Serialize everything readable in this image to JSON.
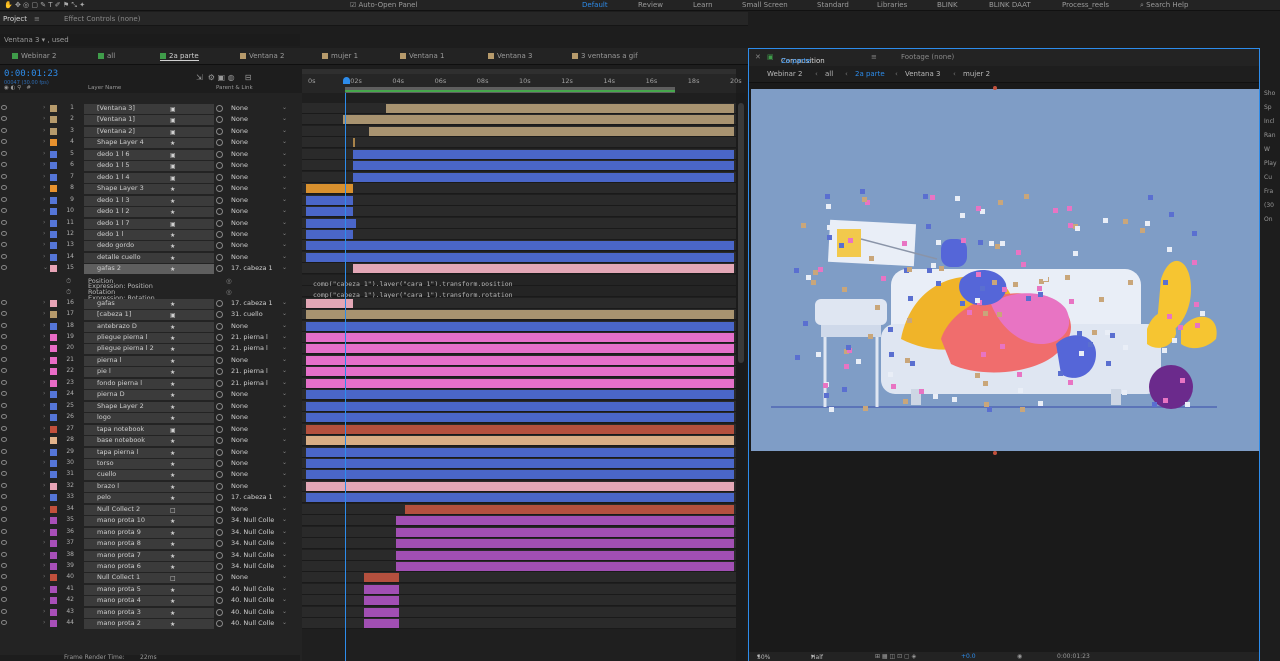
{
  "menubar": {
    "auto_open": "Auto-Open Panel",
    "workspaces": [
      {
        "label": "Default",
        "active": true
      },
      {
        "label": "Review",
        "active": false
      },
      {
        "label": "Learn",
        "active": false
      },
      {
        "label": "Small Screen",
        "active": false
      },
      {
        "label": "Standard",
        "active": false
      },
      {
        "label": "Libraries",
        "active": false
      },
      {
        "label": "BLINK",
        "active": false
      },
      {
        "label": "BLINK DAAT",
        "active": false
      },
      {
        "label": "Process_reels",
        "active": false
      }
    ],
    "search_label": "Search Help"
  },
  "panels": {
    "project": "Project",
    "effect_controls": "Effect Controls (none)",
    "project_item": "Ventana 3 ▾ , used"
  },
  "comp_tabs": [
    {
      "label": "Webinar 2",
      "color": "#3f9c4a",
      "active": false
    },
    {
      "label": "all",
      "color": "#3f9c4a",
      "active": false
    },
    {
      "label": "2a parte",
      "color": "#3f9c4a",
      "active": true
    },
    {
      "label": "Ventana 2",
      "color": "#b69a6b",
      "active": false
    },
    {
      "label": "mujer 1",
      "color": "#b69a6b",
      "active": false
    },
    {
      "label": "Ventana 1",
      "color": "#b69a6b",
      "active": false
    },
    {
      "label": "Ventana 3",
      "color": "#b69a6b",
      "active": false
    },
    {
      "label": "3 ventanas a gif",
      "color": "#b69a6b",
      "active": false
    }
  ],
  "timeline": {
    "timecode": "0:00:01:23",
    "fps": "00047 (30.00 fps)",
    "col_layer_name": "Layer Name",
    "col_parent": "Parent & Link",
    "ruler_ticks": [
      "0s",
      "02s",
      "04s",
      "06s",
      "08s",
      "10s",
      "12s",
      "14s",
      "16s",
      "18s",
      "20s"
    ],
    "frame_render": "Frame Render Time:",
    "frame_render_value": "22ms"
  },
  "layers": [
    {
      "n": "1",
      "name": "[Ventana 3]",
      "parent": "None",
      "label": "#b69a6b",
      "bar": "#a89370",
      "start": 0.19,
      "end": 1.0,
      "kind": "comp"
    },
    {
      "n": "2",
      "name": "[Ventana 1]",
      "parent": "None",
      "label": "#b69a6b",
      "bar": "#a89370",
      "start": 0.09,
      "end": 1.0,
      "kind": "comp"
    },
    {
      "n": "3",
      "name": "[Ventana 2]",
      "parent": "None",
      "label": "#b69a6b",
      "bar": "#a89370",
      "start": 0.15,
      "end": 1.0,
      "kind": "comp"
    },
    {
      "n": "4",
      "name": "Shape Layer 4",
      "parent": "None",
      "label": "#e8922e",
      "bar": "#a8834a",
      "start": 0.113,
      "end": 0.116,
      "kind": "shape"
    },
    {
      "n": "5",
      "name": "dedo 1 l 6",
      "parent": "None",
      "label": "#5576d8",
      "bar": "#4a66c8",
      "start": 0.115,
      "end": 1.0,
      "kind": "comp"
    },
    {
      "n": "6",
      "name": "dedo 1 l 5",
      "parent": "None",
      "label": "#5576d8",
      "bar": "#4a66c8",
      "start": 0.115,
      "end": 1.0,
      "kind": "comp"
    },
    {
      "n": "7",
      "name": "dedo 1 l 4",
      "parent": "None",
      "label": "#5576d8",
      "bar": "#4a66c8",
      "start": 0.115,
      "end": 1.0,
      "kind": "comp"
    },
    {
      "n": "8",
      "name": "Shape Layer 3",
      "parent": "None",
      "label": "#e8922e",
      "bar": "#d8902e",
      "start": 0.005,
      "end": 0.115,
      "kind": "shape"
    },
    {
      "n": "9",
      "name": "dedo 1 l 3",
      "parent": "None",
      "label": "#5576d8",
      "bar": "#4a66c8",
      "start": 0.005,
      "end": 0.115,
      "kind": "shape"
    },
    {
      "n": "10",
      "name": "dedo 1 l 2",
      "parent": "None",
      "label": "#5576d8",
      "bar": "#4a66c8",
      "start": 0.005,
      "end": 0.115,
      "kind": "shape"
    },
    {
      "n": "11",
      "name": "dedo 1 l 7",
      "parent": "None",
      "label": "#5576d8",
      "bar": "#4a66c8",
      "start": 0.005,
      "end": 0.12,
      "kind": "comp"
    },
    {
      "n": "12",
      "name": "dedo 1 l",
      "parent": "None",
      "label": "#5576d8",
      "bar": "#4a66c8",
      "start": 0.005,
      "end": 0.115,
      "kind": "shape"
    },
    {
      "n": "13",
      "name": "dedo gordo",
      "parent": "None",
      "label": "#5576d8",
      "bar": "#4a66c8",
      "start": 0.005,
      "end": 1.0,
      "kind": "shape"
    },
    {
      "n": "14",
      "name": "detalle cuello",
      "parent": "None",
      "label": "#5576d8",
      "bar": "#4a66c8",
      "start": 0.005,
      "end": 1.0,
      "kind": "shape"
    },
    {
      "n": "15",
      "name": "gafas 2",
      "parent": "17. cabeza 1",
      "label": "#e8a4b6",
      "bar": "#e3a7b6",
      "start": 0.115,
      "end": 1.0,
      "kind": "shape",
      "sel": true,
      "open": true
    },
    {
      "prop": "Position",
      "expr_label": "Expression: Position",
      "expr": "comp(\"cabeza 1\").layer(\"cara 1\").transform.position"
    },
    {
      "prop": "Rotation",
      "expr_label": "Expression: Rotation",
      "expr": "comp(\"cabeza 1\").layer(\"cara 1\").transform.rotation"
    },
    {
      "n": "16",
      "name": "gafas",
      "parent": "17. cabeza 1",
      "label": "#e8a4b6",
      "bar": "#e3a7b6",
      "start": 0.005,
      "end": 0.115,
      "kind": "shape"
    },
    {
      "n": "17",
      "name": "[cabeza 1]",
      "parent": "31. cuello",
      "label": "#b69a6b",
      "bar": "#a89370",
      "start": 0.005,
      "end": 1.0,
      "kind": "comp"
    },
    {
      "n": "18",
      "name": "antebrazo D",
      "parent": "None",
      "label": "#5576d8",
      "bar": "#4a66c8",
      "start": 0.005,
      "end": 1.0,
      "kind": "shape"
    },
    {
      "n": "19",
      "name": "pliegue pierna l",
      "parent": "21. pierna l",
      "label": "#e96bc6",
      "bar": "#e56fc9",
      "start": 0.005,
      "end": 1.0,
      "kind": "shape"
    },
    {
      "n": "20",
      "name": "pliegue pierna l 2",
      "parent": "21. pierna l",
      "label": "#e96bc6",
      "bar": "#e56fc9",
      "start": 0.005,
      "end": 1.0,
      "kind": "shape"
    },
    {
      "n": "21",
      "name": "pierna l",
      "parent": "None",
      "label": "#e96bc6",
      "bar": "#e56fc9",
      "start": 0.005,
      "end": 1.0,
      "kind": "shape"
    },
    {
      "n": "22",
      "name": "pie l",
      "parent": "21. pierna l",
      "label": "#e96bc6",
      "bar": "#e56fc9",
      "start": 0.005,
      "end": 1.0,
      "kind": "shape"
    },
    {
      "n": "23",
      "name": "fondo pierna l",
      "parent": "21. pierna l",
      "label": "#e96bc6",
      "bar": "#e56fc9",
      "start": 0.005,
      "end": 1.0,
      "kind": "shape"
    },
    {
      "n": "24",
      "name": "pierna D",
      "parent": "None",
      "label": "#5576d8",
      "bar": "#4a66c8",
      "start": 0.005,
      "end": 1.0,
      "kind": "shape"
    },
    {
      "n": "25",
      "name": "Shape Layer 2",
      "parent": "None",
      "label": "#5576d8",
      "bar": "#4a66c8",
      "start": 0.005,
      "end": 1.0,
      "kind": "shape"
    },
    {
      "n": "26",
      "name": "logo",
      "parent": "None",
      "label": "#5576d8",
      "bar": "#4a66c8",
      "start": 0.005,
      "end": 1.0,
      "kind": "shape"
    },
    {
      "n": "27",
      "name": "tapa notebook",
      "parent": "None",
      "label": "#c2503c",
      "bar": "#b4503e",
      "start": 0.005,
      "end": 1.0,
      "kind": "comp"
    },
    {
      "n": "28",
      "name": "base notebook",
      "parent": "None",
      "label": "#e3b48b",
      "bar": "#d8ad85",
      "start": 0.005,
      "end": 1.0,
      "kind": "shape"
    },
    {
      "n": "29",
      "name": "tapa pierna l",
      "parent": "None",
      "label": "#5576d8",
      "bar": "#4a66c8",
      "start": 0.005,
      "end": 1.0,
      "kind": "shape"
    },
    {
      "n": "30",
      "name": "torso",
      "parent": "None",
      "label": "#5576d8",
      "bar": "#4a66c8",
      "start": 0.005,
      "end": 1.0,
      "kind": "shape"
    },
    {
      "n": "31",
      "name": "cuello",
      "parent": "None",
      "label": "#5576d8",
      "bar": "#4a66c8",
      "start": 0.005,
      "end": 1.0,
      "kind": "shape"
    },
    {
      "n": "32",
      "name": "brazo l",
      "parent": "None",
      "label": "#e8a4b6",
      "bar": "#e3a7b6",
      "start": 0.005,
      "end": 1.0,
      "kind": "shape"
    },
    {
      "n": "33",
      "name": "pelo",
      "parent": "17. cabeza 1",
      "label": "#5576d8",
      "bar": "#4a66c8",
      "start": 0.005,
      "end": 1.0,
      "kind": "shape"
    },
    {
      "n": "34",
      "name": "Null Collect  2",
      "parent": "None",
      "label": "#c2503c",
      "bar": "#b4503e",
      "start": 0.235,
      "end": 1.0,
      "kind": "null"
    },
    {
      "n": "35",
      "name": "mano prota 10",
      "parent": "34. Null Colle",
      "label": "#a84fb8",
      "bar": "#a14fb3",
      "start": 0.215,
      "end": 1.0,
      "kind": "shape"
    },
    {
      "n": "36",
      "name": "mano prota 9",
      "parent": "34. Null Colle",
      "label": "#a84fb8",
      "bar": "#a14fb3",
      "start": 0.215,
      "end": 1.0,
      "kind": "shape"
    },
    {
      "n": "37",
      "name": "mano prota 8",
      "parent": "34. Null Colle",
      "label": "#a84fb8",
      "bar": "#a14fb3",
      "start": 0.215,
      "end": 1.0,
      "kind": "shape"
    },
    {
      "n": "38",
      "name": "mano prota 7",
      "parent": "34. Null Colle",
      "label": "#a84fb8",
      "bar": "#a14fb3",
      "start": 0.215,
      "end": 1.0,
      "kind": "shape"
    },
    {
      "n": "39",
      "name": "mano prota 6",
      "parent": "34. Null Colle",
      "label": "#a84fb8",
      "bar": "#a14fb3",
      "start": 0.215,
      "end": 1.0,
      "kind": "shape"
    },
    {
      "n": "40",
      "name": "Null Collect  1",
      "parent": "None",
      "label": "#c2503c",
      "bar": "#b4503e",
      "start": 0.14,
      "end": 0.22,
      "kind": "null"
    },
    {
      "n": "41",
      "name": "mano prota 5",
      "parent": "40. Null Colle",
      "label": "#a84fb8",
      "bar": "#a14fb3",
      "start": 0.14,
      "end": 0.22,
      "kind": "shape"
    },
    {
      "n": "42",
      "name": "mano prota 4",
      "parent": "40. Null Colle",
      "label": "#a84fb8",
      "bar": "#a14fb3",
      "start": 0.14,
      "end": 0.22,
      "kind": "shape"
    },
    {
      "n": "43",
      "name": "mano prota 3",
      "parent": "40. Null Colle",
      "label": "#a84fb8",
      "bar": "#a14fb3",
      "start": 0.14,
      "end": 0.22,
      "kind": "shape"
    },
    {
      "n": "44",
      "name": "mano prota 2",
      "parent": "40. Null Colle",
      "label": "#a84fb8",
      "bar": "#a14fb3",
      "start": 0.14,
      "end": 0.22,
      "kind": "shape"
    }
  ],
  "composition": {
    "tab": "Composition",
    "tab_name": "2a parte",
    "footage": "Footage (none)",
    "crumbs": [
      "Webinar 2",
      "all",
      "2a parte",
      "Ventana 3",
      "mujer 2"
    ],
    "zoom": "50%",
    "resolution": "Half",
    "timecode": "0:00:01:23",
    "exposure": "+0.0"
  },
  "side_panel": [
    "Sho",
    "Sp",
    "Incl",
    "Ran",
    "W",
    "Play",
    "Cu",
    "Fra",
    "(30",
    "On"
  ]
}
